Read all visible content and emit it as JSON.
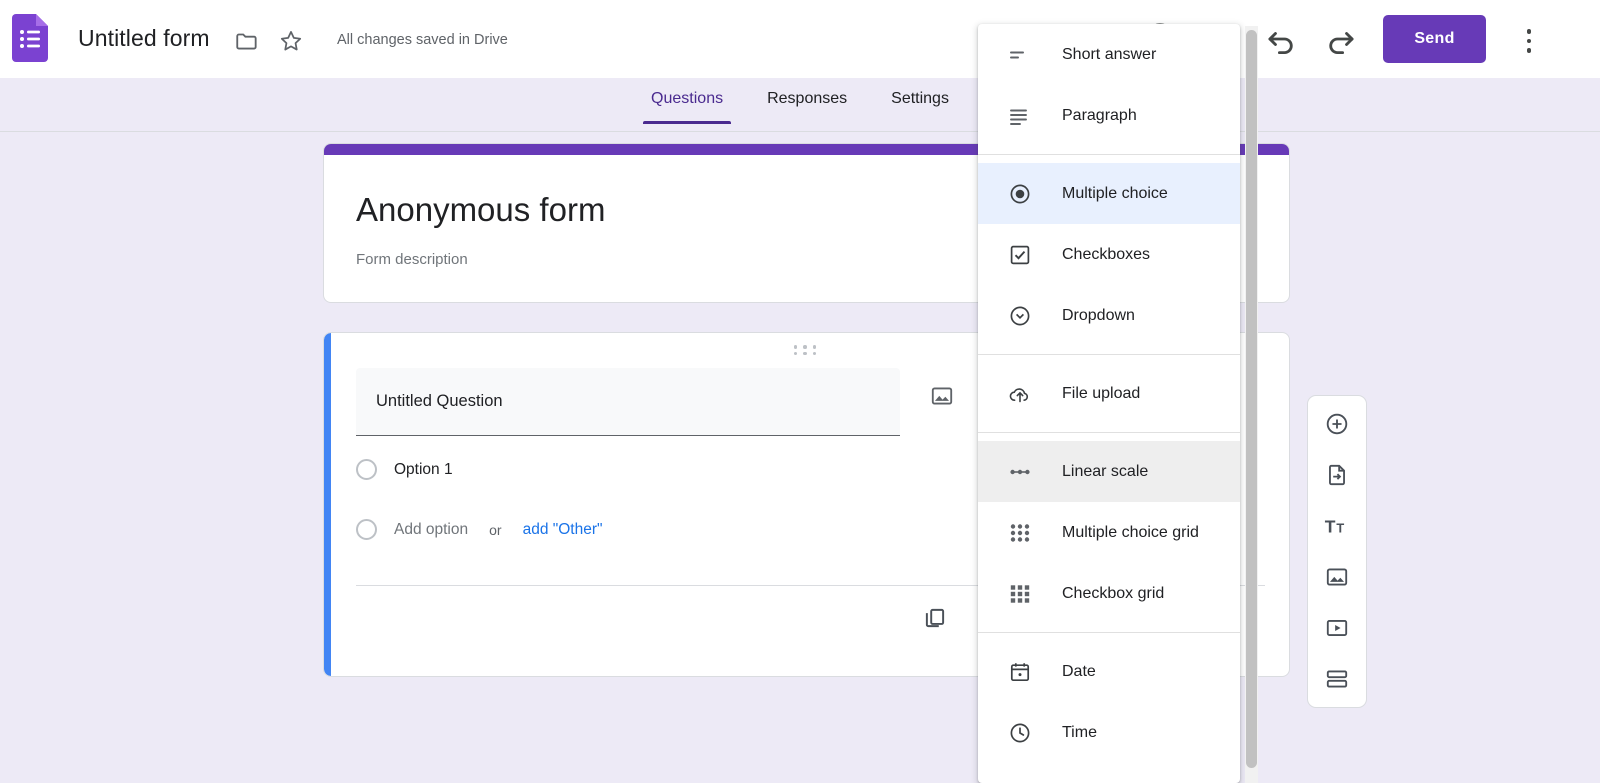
{
  "topbar": {
    "logo_icon": "google-forms-logo-icon",
    "doc_title": "Untitled form",
    "folder_icon": "move-to-folder-icon",
    "star_icon": "star-icon",
    "save_status": "All changes saved in Drive",
    "palette_icon": "theme-palette-icon",
    "eye_icon": "preview-eye-icon",
    "undo_icon": "undo-icon",
    "redo_icon": "redo-icon",
    "send_label": "Send",
    "more_icon": "more-options-kebab-icon"
  },
  "tabs": [
    {
      "label": "Questions",
      "active": true
    },
    {
      "label": "Responses",
      "active": false
    },
    {
      "label": "Settings",
      "active": false
    }
  ],
  "form": {
    "title": "Anonymous form",
    "description": "Form description",
    "accent_color": "#673AB7"
  },
  "question": {
    "accent_color": "#4285F4",
    "drag_handle_icon": "drag-handle-icon",
    "title": "Untitled Question",
    "image_icon": "add-image-icon",
    "duplicate_icon": "duplicate-icon",
    "options": [
      {
        "label": "Option 1",
        "placeholder": false
      },
      {
        "label": "Add option",
        "placeholder": true
      }
    ],
    "or_text": "or",
    "add_other_label": "add \"Other\""
  },
  "sidebar_toolbar": [
    {
      "icon": "add-question-icon"
    },
    {
      "icon": "import-questions-icon"
    },
    {
      "icon": "add-title-and-description-icon"
    },
    {
      "icon": "add-image-icon"
    },
    {
      "icon": "add-video-icon"
    },
    {
      "icon": "add-section-icon"
    }
  ],
  "type_menu": {
    "groups": [
      {
        "items": [
          {
            "label": "Short answer",
            "icon": "short-answer-icon",
            "state": "normal"
          },
          {
            "label": "Paragraph",
            "icon": "paragraph-icon",
            "state": "normal"
          }
        ]
      },
      {
        "items": [
          {
            "label": "Multiple choice",
            "icon": "radio-button-icon",
            "state": "selected"
          },
          {
            "label": "Checkboxes",
            "icon": "checkbox-icon",
            "state": "normal"
          },
          {
            "label": "Dropdown",
            "icon": "dropdown-icon",
            "state": "normal"
          }
        ]
      },
      {
        "items": [
          {
            "label": "File upload",
            "icon": "file-upload-icon",
            "state": "normal"
          }
        ]
      },
      {
        "items": [
          {
            "label": "Linear scale",
            "icon": "linear-scale-icon",
            "state": "hovered"
          },
          {
            "label": "Multiple choice grid",
            "icon": "multiple-choice-grid-icon",
            "state": "normal"
          },
          {
            "label": "Checkbox grid",
            "icon": "checkbox-grid-icon",
            "state": "normal"
          }
        ]
      },
      {
        "items": [
          {
            "label": "Date",
            "icon": "calendar-icon",
            "state": "normal"
          },
          {
            "label": "Time",
            "icon": "clock-icon",
            "state": "normal"
          }
        ]
      }
    ]
  },
  "colors": {
    "page_background": "#EDEAF6",
    "brand_purple": "#673AB7",
    "tab_active": "#4A2A8F",
    "question_accent_blue": "#4285F4",
    "link_blue": "#1a73e8",
    "selected_menu_bg": "#E8F0FE",
    "hovered_menu_bg": "#EEEEEE"
  }
}
